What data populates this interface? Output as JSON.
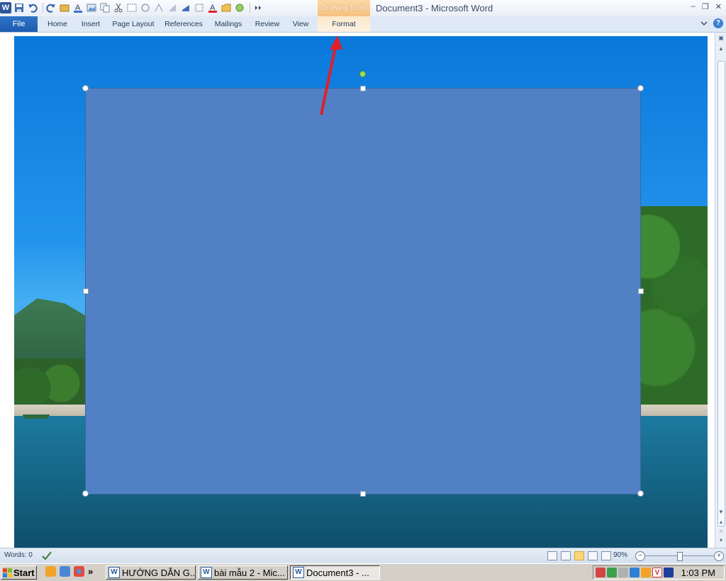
{
  "window": {
    "title": "Document3  -  Microsoft Word",
    "app_logo": "W",
    "controls": [
      "–",
      "❐",
      "✕"
    ]
  },
  "contextual_tab": {
    "group": "Drawing Tools",
    "tab": "Format"
  },
  "ribbon": {
    "file_label": "File",
    "tabs": [
      "Home",
      "Insert",
      "Page Layout",
      "References",
      "Mailings",
      "Review",
      "View"
    ]
  },
  "qat_icons": [
    "save-icon",
    "undo-icon",
    "redo-icon",
    "insert-icon",
    "font-color-icon",
    "picture-icon",
    "copy-icon",
    "cut-icon",
    "text-box-icon",
    "symbol-icon",
    "format-icon",
    "align-icon",
    "paragraph-icon",
    "font-color-icon",
    "open-icon",
    "shape-icon",
    "more-icon"
  ],
  "annotation": {
    "arrow_color": "#e0202a"
  },
  "shape": {
    "fill": "#5181c4"
  },
  "statusbar": {
    "words": "Words: 0",
    "zoom": "90%",
    "zoom_minus": "−",
    "zoom_plus": "+",
    "zoom_level": 0.5
  },
  "taskbar": {
    "start_label": "Start",
    "chevron": "»",
    "buttons": [
      {
        "label": "HƯỚNG DẪN G...",
        "active": false
      },
      {
        "label": "bài mẫu 2 - Mic...",
        "active": false
      },
      {
        "label": "Document3 - ...",
        "active": true
      }
    ],
    "clock": "1:03 PM",
    "tray_icon_letter": "V"
  }
}
